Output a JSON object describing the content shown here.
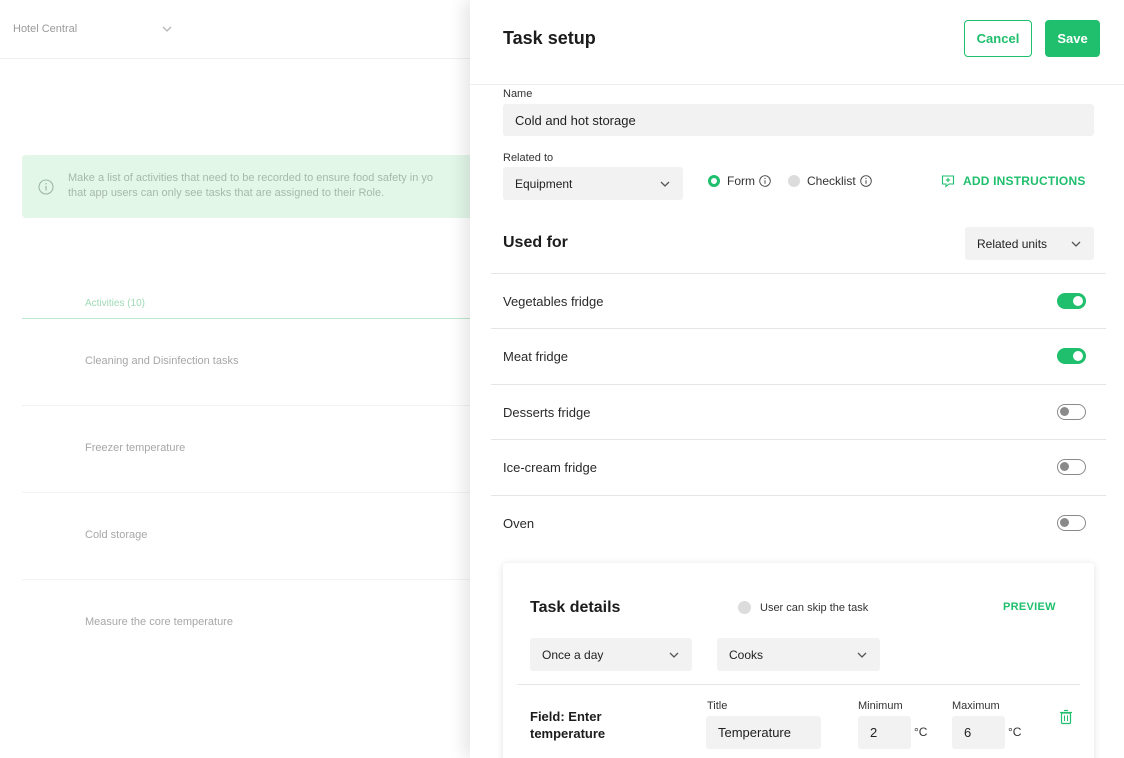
{
  "background": {
    "hotel_select": "Hotel Central",
    "info_text_line1": "Make a list of activities that need to be recorded to ensure food safety in yo",
    "info_text_line2": "that app users can only see tasks that are assigned to their Role.",
    "activities_tab": "Activities (10)",
    "activities": [
      "Cleaning and Disinfection tasks",
      "Freezer temperature",
      "Cold storage",
      "Measure the core temperature"
    ]
  },
  "panel": {
    "title": "Task setup",
    "cancel_label": "Cancel",
    "save_label": "Save",
    "name_label": "Name",
    "name_value": "Cold and hot storage",
    "related_to_label": "Related to",
    "related_to_value": "Equipment",
    "type_options": [
      {
        "label": "Form",
        "selected": true
      },
      {
        "label": "Checklist",
        "selected": false
      }
    ],
    "add_instructions_label": "ADD INSTRUCTIONS",
    "used_for_title": "Used for",
    "related_units_select": "Related units",
    "units": [
      {
        "label": "Vegetables fridge",
        "enabled": true
      },
      {
        "label": "Meat fridge",
        "enabled": true
      },
      {
        "label": "Desserts fridge",
        "enabled": false
      },
      {
        "label": "Ice-cream fridge",
        "enabled": false
      },
      {
        "label": "Oven",
        "enabled": false
      }
    ],
    "task_details": {
      "title": "Task details",
      "skip_label": "User can skip the task",
      "preview_label": "PREVIEW",
      "frequency_value": "Once a day",
      "role_value": "Cooks",
      "field_label_line1": "Field: Enter",
      "field_label_line2": "temperature",
      "title_label": "Title",
      "title_value": "Temperature",
      "minimum_label": "Minimum",
      "minimum_value": "2",
      "maximum_label": "Maximum",
      "maximum_value": "6",
      "unit": "°C"
    }
  },
  "colors": {
    "accent": "#1fbf6d",
    "info_bg": "#e3f7e9"
  },
  "icons": [
    "chevron-down-icon",
    "info-icon",
    "add-instructions-icon",
    "trash-icon"
  ]
}
